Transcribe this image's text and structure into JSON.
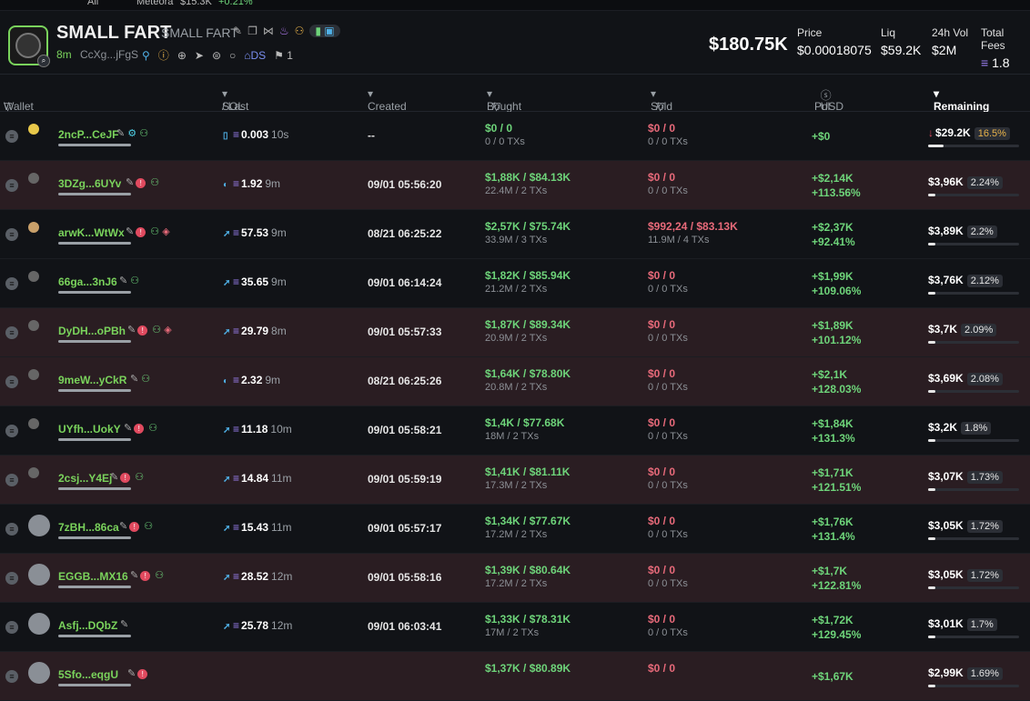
{
  "topstrip": {
    "filter": "All",
    "ticker_name": "Meteora",
    "ticker_value": "$15.3K",
    "ticker_change": "+0.21%"
  },
  "token": {
    "name": "SMALL FART",
    "symbol": "SMALL FART",
    "age": "8m",
    "address": "CcXg...jFgS",
    "ds_label": "DS",
    "holders_count": "1",
    "market_cap": "$180.75K",
    "icons": [
      "edit-icon",
      "copy-icon",
      "share-icon",
      "fire-icon",
      "people-icon",
      "social-icon"
    ]
  },
  "stats": [
    {
      "label": "Price",
      "value": "$0.00018075"
    },
    {
      "label": "Liq",
      "value": "$59.2K"
    },
    {
      "label": "24h Vol",
      "value": "$2M"
    },
    {
      "label": "Total Fees",
      "value": "1.8"
    }
  ],
  "columns": {
    "wallet": "Wallet",
    "sol_bal": "SOL Bal",
    "last_active": "/ Last Active",
    "created": "Created",
    "bought": "Bought",
    "bought_avg": "/ Avg MC",
    "sold": "Sold",
    "sold_avg": "/ Avg MC",
    "pnl": "Pnl",
    "usd": "USD",
    "remaining": "Remaining"
  },
  "rows": [
    {
      "name": "2ncP...CeJF",
      "bal": "0.003",
      "active": "10s",
      "created": "--",
      "bought": "$0 / 0",
      "bought_tx": "0 / 0 TXs",
      "sold": "$0 / 0",
      "sold_tx": "0 / 0 TXs",
      "pnl": "+$0",
      "pnl_pct": "",
      "rem": "$29.2K",
      "rem_pct": "16.5%",
      "rem_fill": 0.165,
      "avatar": false,
      "down": true,
      "hi": true,
      "reds": 0
    },
    {
      "name": "3DZg...6UYv",
      "bal": "1.92",
      "active": "9m",
      "created": "09/01 05:56:20",
      "bought": "$1,88K / $84.13K",
      "bought_tx": "22.4M / 2 TXs",
      "sold": "$0 / 0",
      "sold_tx": "0 / 0 TXs",
      "pnl": "+$2,14K",
      "pnl_pct": "+113.56%",
      "rem": "$3,96K",
      "rem_pct": "2.24%",
      "rem_fill": 0.0224,
      "avatar": false,
      "down": false,
      "hi": false,
      "reds": 1
    },
    {
      "name": "arwK...WtWx",
      "bal": "57.53",
      "active": "9m",
      "created": "08/21 06:25:22",
      "bought": "$2,57K / $75.74K",
      "bought_tx": "33.9M / 3 TXs",
      "sold": "$992,24 / $83.13K",
      "sold_tx": "11.9M / 4 TXs",
      "pnl": "+$2,37K",
      "pnl_pct": "+92.41%",
      "rem": "$3,89K",
      "rem_pct": "2.2%",
      "rem_fill": 0.022,
      "avatar": false,
      "down": false,
      "hi": false,
      "reds": 1
    },
    {
      "name": "66ga...3nJ6",
      "bal": "35.65",
      "active": "9m",
      "created": "09/01 06:14:24",
      "bought": "$1,82K / $85.94K",
      "bought_tx": "21.2M / 2 TXs",
      "sold": "$0 / 0",
      "sold_tx": "0 / 0 TXs",
      "pnl": "+$1,99K",
      "pnl_pct": "+109.06%",
      "rem": "$3,76K",
      "rem_pct": "2.12%",
      "rem_fill": 0.0212,
      "avatar": false,
      "down": false,
      "hi": false,
      "reds": 0
    },
    {
      "name": "DyDH...oPBh",
      "bal": "29.79",
      "active": "8m",
      "created": "09/01 05:57:33",
      "bought": "$1,87K / $89.34K",
      "bought_tx": "20.9M / 2 TXs",
      "sold": "$0 / 0",
      "sold_tx": "0 / 0 TXs",
      "pnl": "+$1,89K",
      "pnl_pct": "+101.12%",
      "rem": "$3,7K",
      "rem_pct": "2.09%",
      "rem_fill": 0.0209,
      "avatar": false,
      "down": false,
      "hi": false,
      "reds": 1
    },
    {
      "name": "9meW...yCkR",
      "bal": "2.32",
      "active": "9m",
      "created": "08/21 06:25:26",
      "bought": "$1,64K / $78.80K",
      "bought_tx": "20.8M / 2 TXs",
      "sold": "$0 / 0",
      "sold_tx": "0 / 0 TXs",
      "pnl": "+$2,1K",
      "pnl_pct": "+128.03%",
      "rem": "$3,69K",
      "rem_pct": "2.08%",
      "rem_fill": 0.0208,
      "avatar": false,
      "down": false,
      "hi": false,
      "reds": 0
    },
    {
      "name": "UYfh...UokY",
      "bal": "11.18",
      "active": "10m",
      "created": "09/01 05:58:21",
      "bought": "$1,4K / $77.68K",
      "bought_tx": "18M / 2 TXs",
      "sold": "$0 / 0",
      "sold_tx": "0 / 0 TXs",
      "pnl": "+$1,84K",
      "pnl_pct": "+131.3%",
      "rem": "$3,2K",
      "rem_pct": "1.8%",
      "rem_fill": 0.018,
      "avatar": false,
      "down": false,
      "hi": false,
      "reds": 1
    },
    {
      "name": "2csj...Y4Ej",
      "bal": "14.84",
      "active": "11m",
      "created": "09/01 05:59:19",
      "bought": "$1,41K / $81.11K",
      "bought_tx": "17.3M / 2 TXs",
      "sold": "$0 / 0",
      "sold_tx": "0 / 0 TXs",
      "pnl": "+$1,71K",
      "pnl_pct": "+121.51%",
      "rem": "$3,07K",
      "rem_pct": "1.73%",
      "rem_fill": 0.0173,
      "avatar": false,
      "down": false,
      "hi": false,
      "reds": 1
    },
    {
      "name": "7zBH...86ca",
      "bal": "15.43",
      "active": "11m",
      "created": "09/01 05:57:17",
      "bought": "$1,34K / $77.67K",
      "bought_tx": "17.2M / 2 TXs",
      "sold": "$0 / 0",
      "sold_tx": "0 / 0 TXs",
      "pnl": "+$1,76K",
      "pnl_pct": "+131.4%",
      "rem": "$3,05K",
      "rem_pct": "1.72%",
      "rem_fill": 0.0172,
      "avatar": true,
      "down": false,
      "hi": false,
      "reds": 1
    },
    {
      "name": "EGGB...MX16",
      "bal": "28.52",
      "active": "12m",
      "created": "09/01 05:58:16",
      "bought": "$1,39K / $80.64K",
      "bought_tx": "17.2M / 2 TXs",
      "sold": "$0 / 0",
      "sold_tx": "0 / 0 TXs",
      "pnl": "+$1,7K",
      "pnl_pct": "+122.81%",
      "rem": "$3,05K",
      "rem_pct": "1.72%",
      "rem_fill": 0.0172,
      "avatar": true,
      "down": false,
      "hi": false,
      "reds": 1
    },
    {
      "name": "Asfj...DQbZ",
      "bal": "25.78",
      "active": "12m",
      "created": "09/01 06:03:41",
      "bought": "$1,33K / $78.31K",
      "bought_tx": "17M / 2 TXs",
      "sold": "$0 / 0",
      "sold_tx": "0 / 0 TXs",
      "pnl": "+$1,72K",
      "pnl_pct": "+129.45%",
      "rem": "$3,01K",
      "rem_pct": "1.7%",
      "rem_fill": 0.017,
      "avatar": true,
      "down": false,
      "hi": false,
      "reds": 0
    },
    {
      "name": "5Sfo...eqgU",
      "bal": "",
      "active": "",
      "created": "",
      "bought": "$1,37K / $80.89K",
      "bought_tx": "",
      "sold": "$0 / 0",
      "sold_tx": "",
      "pnl": "+$1,67K",
      "pnl_pct": "",
      "rem": "$2,99K",
      "rem_pct": "1.69%",
      "rem_fill": 0.0169,
      "avatar": true,
      "down": false,
      "hi": false,
      "reds": 1
    }
  ],
  "colors": {
    "accent_green": "#7ad35c",
    "pnl_green": "#6ed47a",
    "sold_red": "#e86a7a",
    "row_alt": "#2a1d22"
  }
}
